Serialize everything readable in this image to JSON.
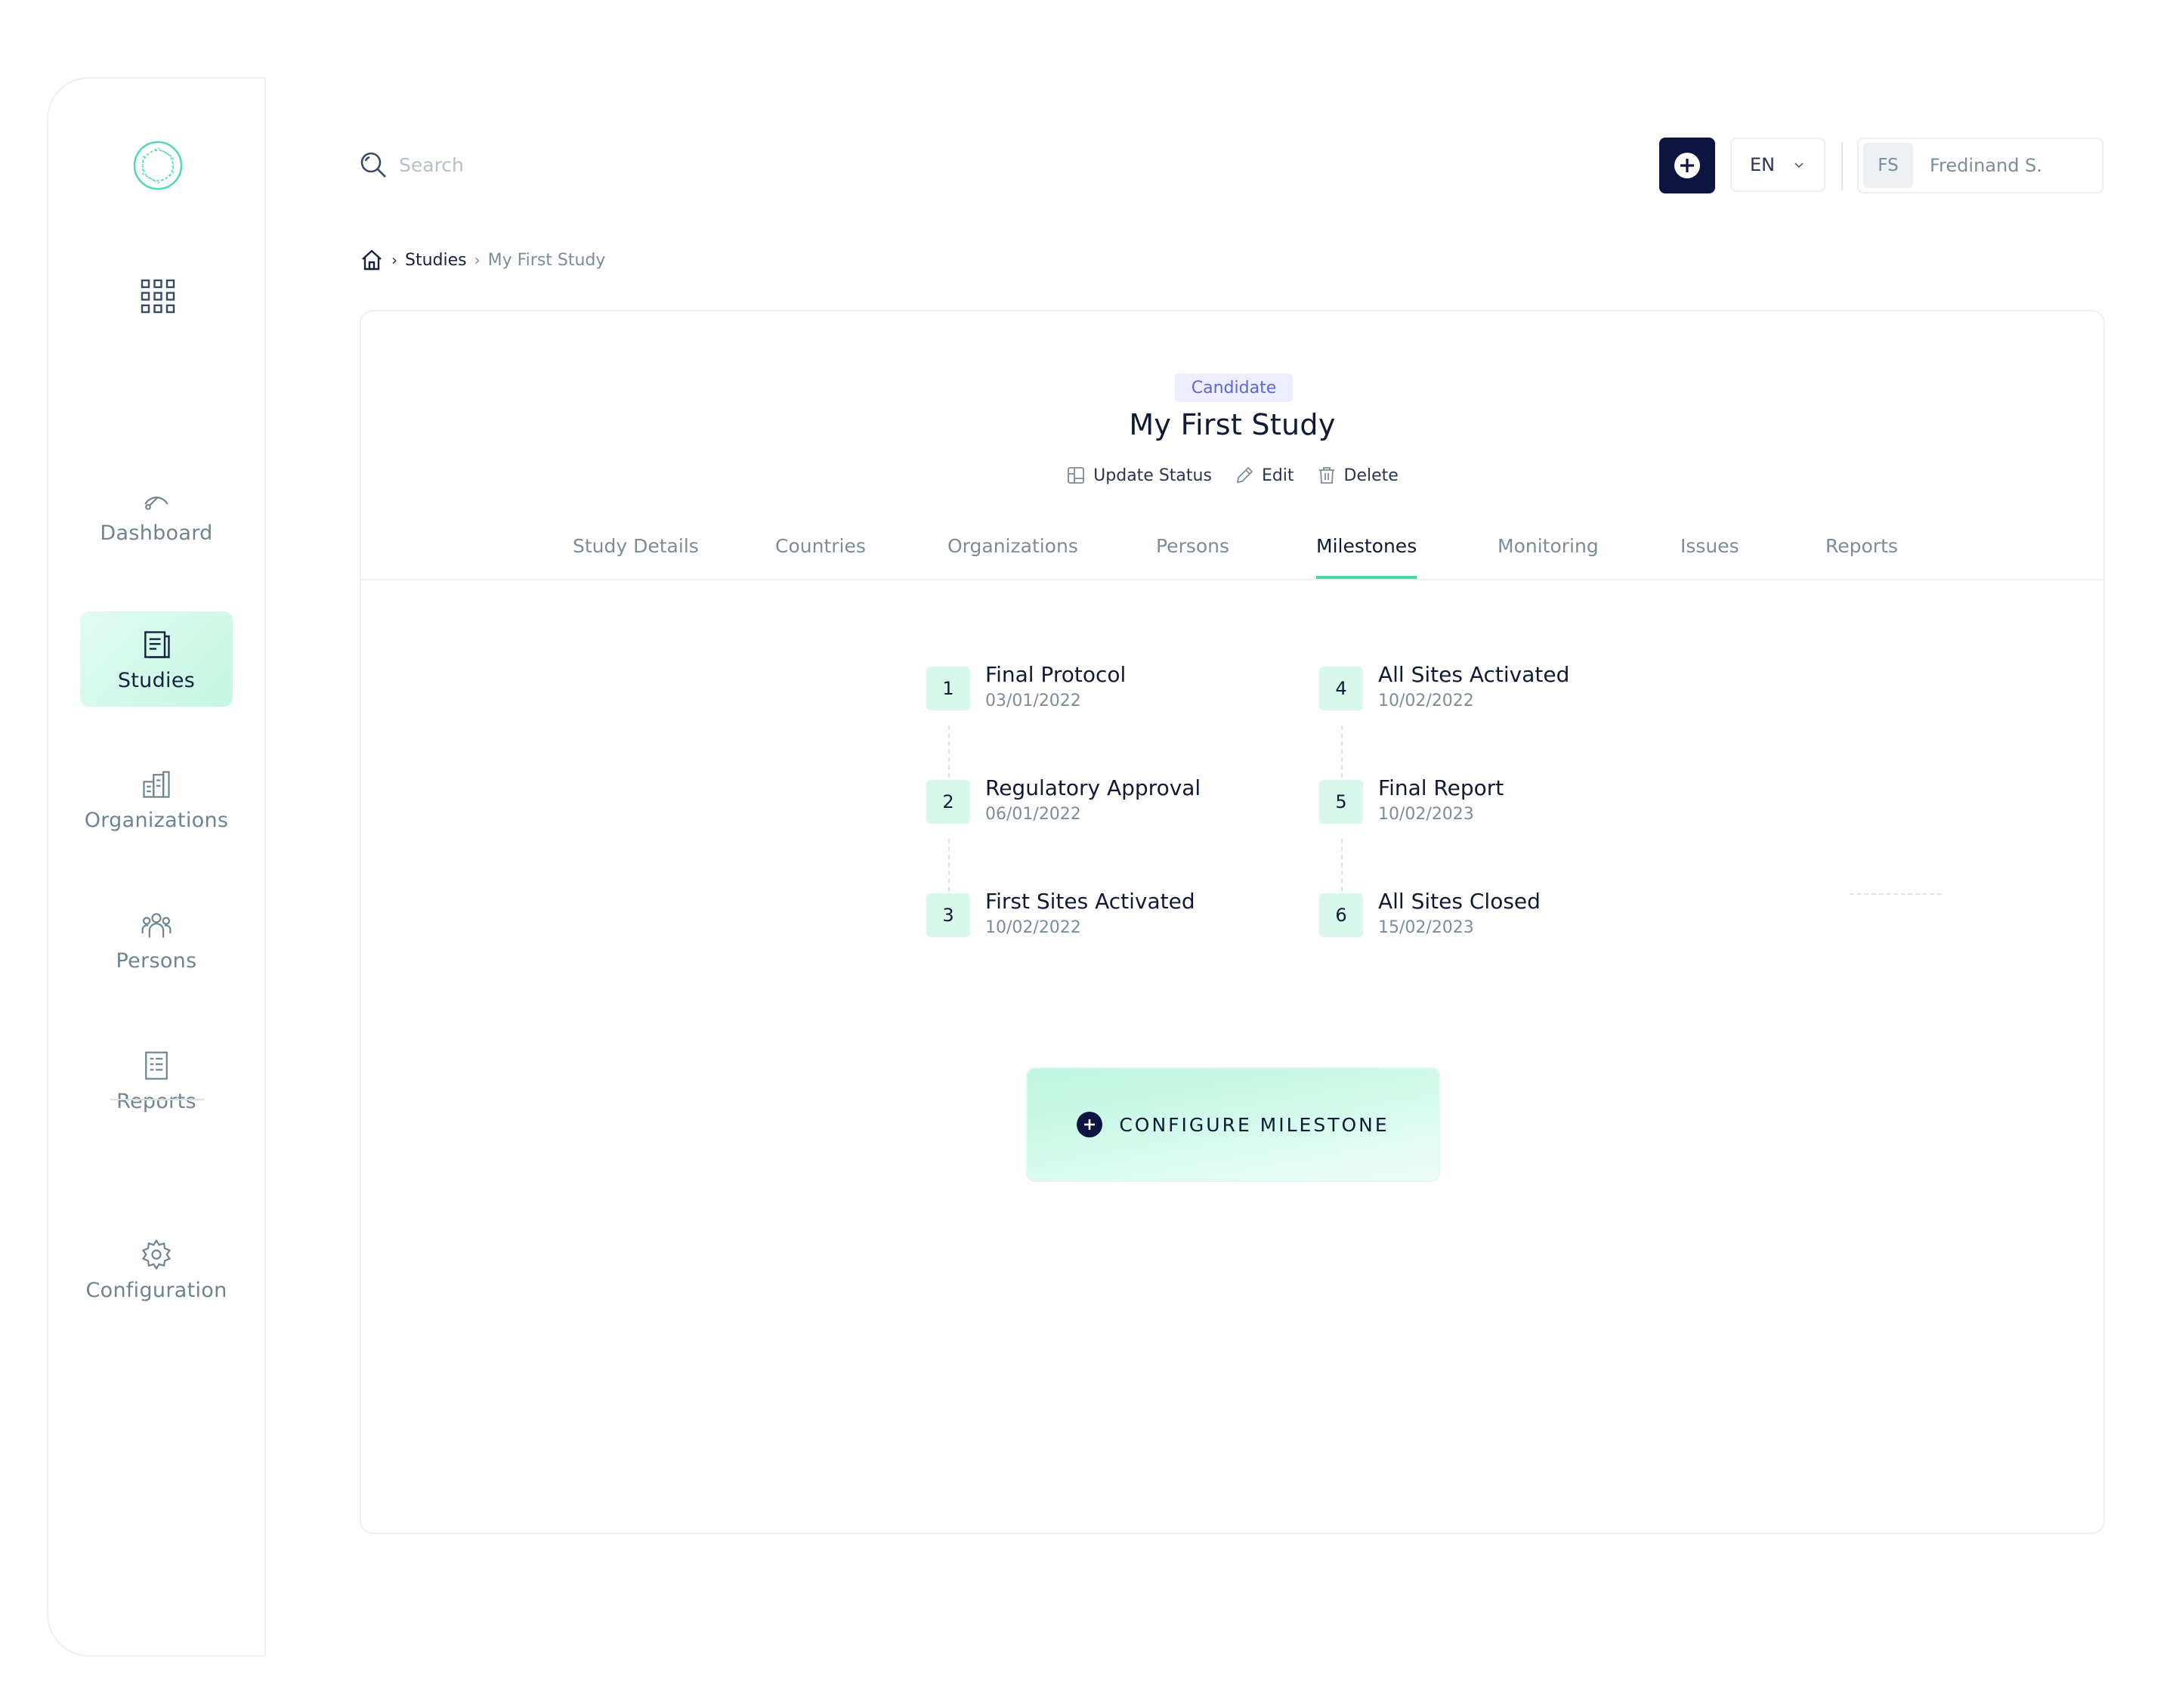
{
  "sidebar": {
    "logo": "atom-logo-icon",
    "apps": "grid-icon",
    "items": [
      {
        "label": "Dashboard",
        "icon": "gauge-icon"
      },
      {
        "label": "Studies",
        "icon": "document-icon",
        "active": true
      },
      {
        "label": "Organizations",
        "icon": "buildings-icon"
      },
      {
        "label": "Persons",
        "icon": "people-icon"
      },
      {
        "label": "Reports",
        "icon": "report-icon"
      },
      {
        "label": "Configuration",
        "icon": "gear-icon"
      }
    ]
  },
  "header": {
    "search_placeholder": "Search",
    "language": "EN",
    "user_initials": "FS",
    "user_name": "Fredinand S."
  },
  "breadcrumb": {
    "items": [
      "Studies",
      "My First Study"
    ]
  },
  "study": {
    "status": "Candidate",
    "title": "My First Study",
    "actions": {
      "update_status": "Update Status",
      "edit": "Edit",
      "delete": "Delete"
    }
  },
  "tabs": [
    {
      "label": "Study Details"
    },
    {
      "label": "Countries"
    },
    {
      "label": "Organizations"
    },
    {
      "label": "Persons"
    },
    {
      "label": "Milestones",
      "active": true
    },
    {
      "label": "Monitoring"
    },
    {
      "label": "Issues"
    },
    {
      "label": "Reports"
    }
  ],
  "milestones": [
    {
      "num": "1",
      "name": "Final Protocol",
      "date": "03/01/2022"
    },
    {
      "num": "2",
      "name": "Regulatory Approval",
      "date": "06/01/2022"
    },
    {
      "num": "3",
      "name": "First Sites Activated",
      "date": "10/02/2022"
    },
    {
      "num": "4",
      "name": "All Sites Activated",
      "date": "10/02/2022"
    },
    {
      "num": "5",
      "name": "Final Report",
      "date": "10/02/2023"
    },
    {
      "num": "6",
      "name": "All Sites Closed",
      "date": "15/02/2023"
    }
  ],
  "configure_button": "CONFIGURE MILESTONE",
  "colors": {
    "accent": "#43dba3",
    "primary_dark": "#0c1540",
    "badge_bg": "#eceeff",
    "badge_text": "#5b67d6"
  }
}
